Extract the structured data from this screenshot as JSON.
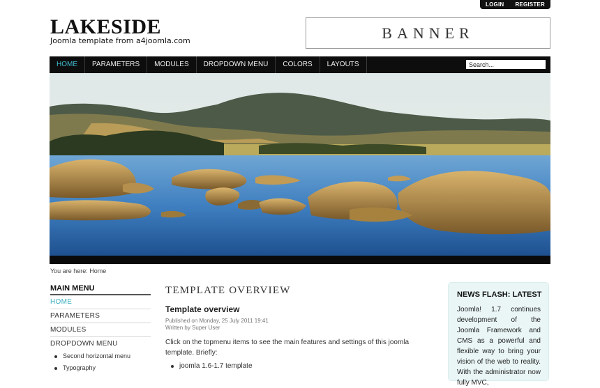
{
  "top_links": {
    "login": "LOGIN",
    "register": "REGISTER"
  },
  "logo": {
    "title": "LAKESIDE",
    "subtitle": "Joomla template from a4joomla.com"
  },
  "banner": {
    "text": "BANNER"
  },
  "nav": {
    "items": [
      {
        "label": "HOME",
        "active": true
      },
      {
        "label": "PARAMETERS"
      },
      {
        "label": "MODULES"
      },
      {
        "label": "DROPDOWN MENU"
      },
      {
        "label": "COLORS"
      },
      {
        "label": "LAYOUTS"
      }
    ],
    "search_value": "Search..."
  },
  "hero": {
    "image": "lake-landscape-photo"
  },
  "breadcrumb": {
    "text": "You are here: Home"
  },
  "main_menu": {
    "title": "MAIN MENU",
    "items": [
      "HOME",
      "PARAMETERS",
      "MODULES",
      "DROPDOWN MENU"
    ],
    "sub_items": [
      "Second horizontal menu",
      "Typography"
    ]
  },
  "article": {
    "section_heading": "TEMPLATE OVERVIEW",
    "title": "Template overview",
    "published": "Published on Monday, 25 July 2011 19:41",
    "author": "Written by Super User",
    "body": "Click on the topmenu items to see the main features and settings of this joomla template. Briefly:",
    "list": [
      "joomla 1.6-1.7 template"
    ]
  },
  "news_flash": {
    "title": "NEWS FLASH: LATEST",
    "body": "Joomla! 1.7 continues development of the Joomla Framework and CMS as a powerful and flexible way to bring your vision of the web to reality. With the administrator now fully MVC,"
  },
  "colors": {
    "accent": "#3fbfd2",
    "nav_bg": "#0d0d0d",
    "news_bg": "#eaf6f6"
  }
}
